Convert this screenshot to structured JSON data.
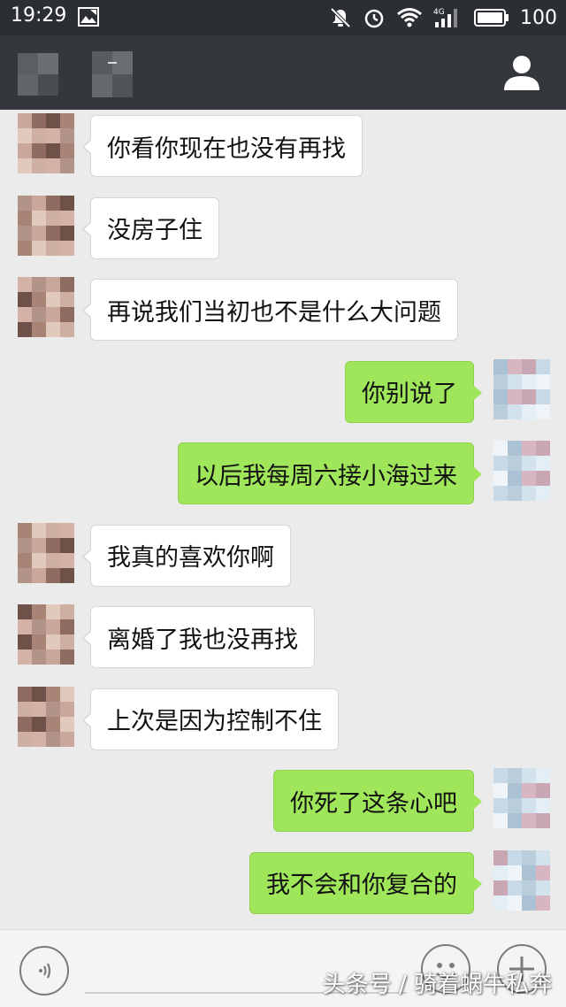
{
  "status_bar": {
    "time": "19:29",
    "battery": "100",
    "icons": [
      "image-icon",
      "mute-icon",
      "alarm-icon",
      "wifi-icon",
      "signal-4g-icon",
      "battery-icon"
    ]
  },
  "header": {
    "icons": [
      "blurred-name",
      "profile-icon"
    ]
  },
  "messages": [
    {
      "side": "in",
      "text": "你看你现在也没有再找"
    },
    {
      "side": "in",
      "text": "没房子住"
    },
    {
      "side": "in",
      "text": "再说我们当初也不是什么大问题"
    },
    {
      "side": "out",
      "text": "你别说了"
    },
    {
      "side": "out",
      "text": "以后我每周六接小海过来"
    },
    {
      "side": "in",
      "text": "我真的喜欢你啊"
    },
    {
      "side": "in",
      "text": "离婚了我也没再找"
    },
    {
      "side": "in",
      "text": "上次是因为控制不住"
    },
    {
      "side": "out",
      "text": "你死了这条心吧"
    },
    {
      "side": "out",
      "text": "我不会和你复合的"
    }
  ],
  "input_bar": {
    "icons": [
      "voice-icon",
      "emoji-icon",
      "plus-icon"
    ]
  },
  "watermark": "头条号 / 骑着蜗牛私奔",
  "colors": {
    "status_bg": "#2b2e33",
    "header_bg": "#34373c",
    "chat_bg": "#ebebeb",
    "bubble_in": "#ffffff",
    "bubble_out": "#9fe65a"
  }
}
